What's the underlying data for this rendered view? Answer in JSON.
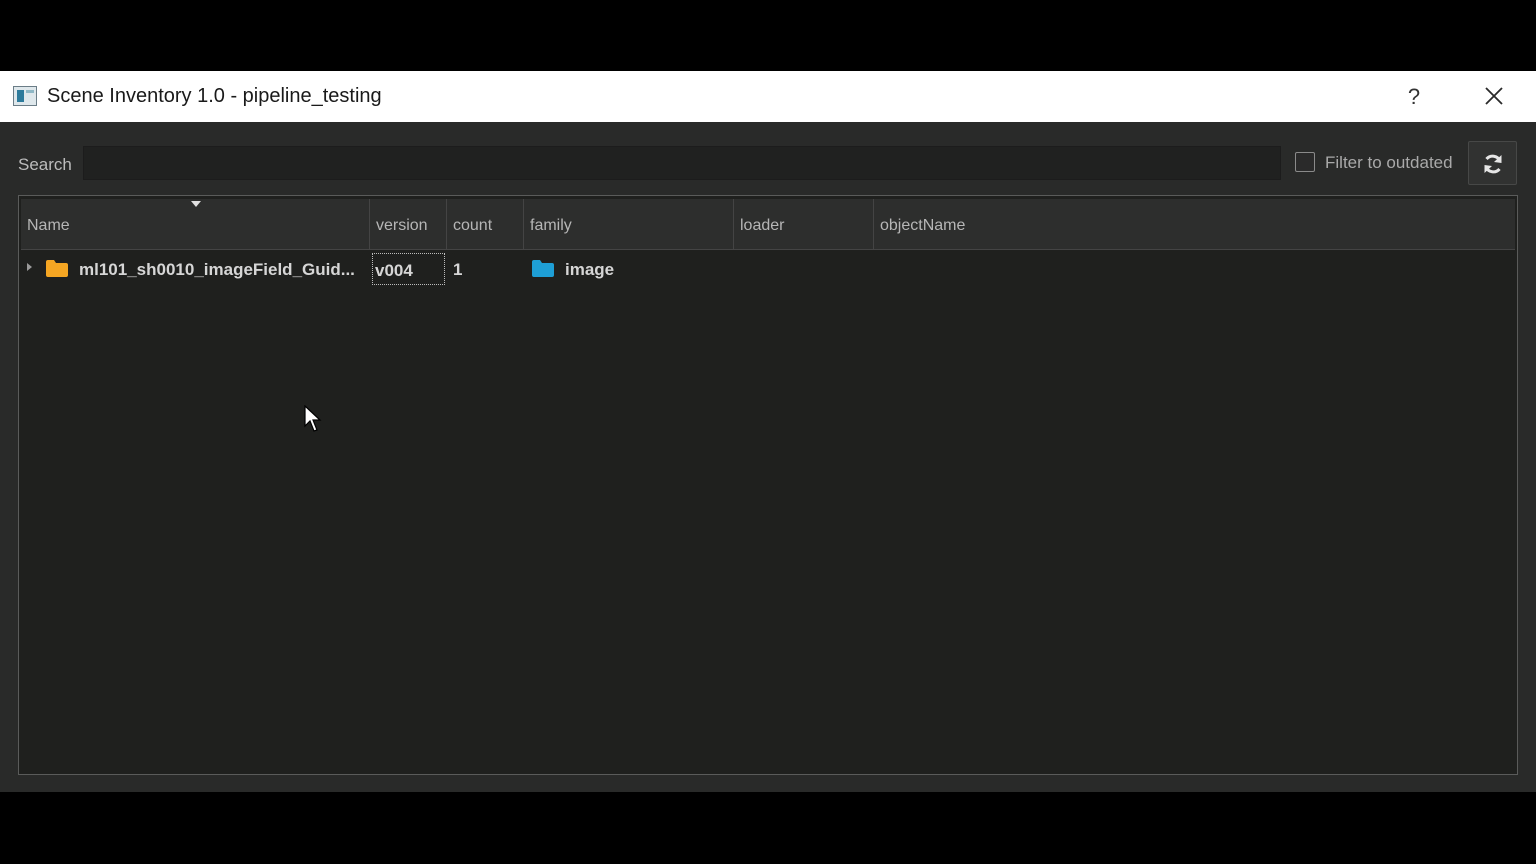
{
  "window": {
    "title": "Scene Inventory 1.0 - pipeline_testing",
    "help_label": "?"
  },
  "toolbar": {
    "search_label": "Search",
    "search_value": "",
    "search_placeholder": "",
    "filter_label": "Filter to outdated",
    "filter_checked": false
  },
  "table": {
    "columns": [
      "Name",
      "version",
      "count",
      "family",
      "loader",
      "objectName"
    ],
    "sort_column": "Name",
    "rows": [
      {
        "name": "ml101_sh0010_imageField_Guid...",
        "version": "v004",
        "count": "1",
        "family": "image",
        "loader": "",
        "objectName": "",
        "expanded": false
      }
    ]
  },
  "colors": {
    "background": "#292a29",
    "titlebar": "#ffffff",
    "folder_orange": "#f5a623",
    "folder_blue": "#1e9fd6"
  }
}
